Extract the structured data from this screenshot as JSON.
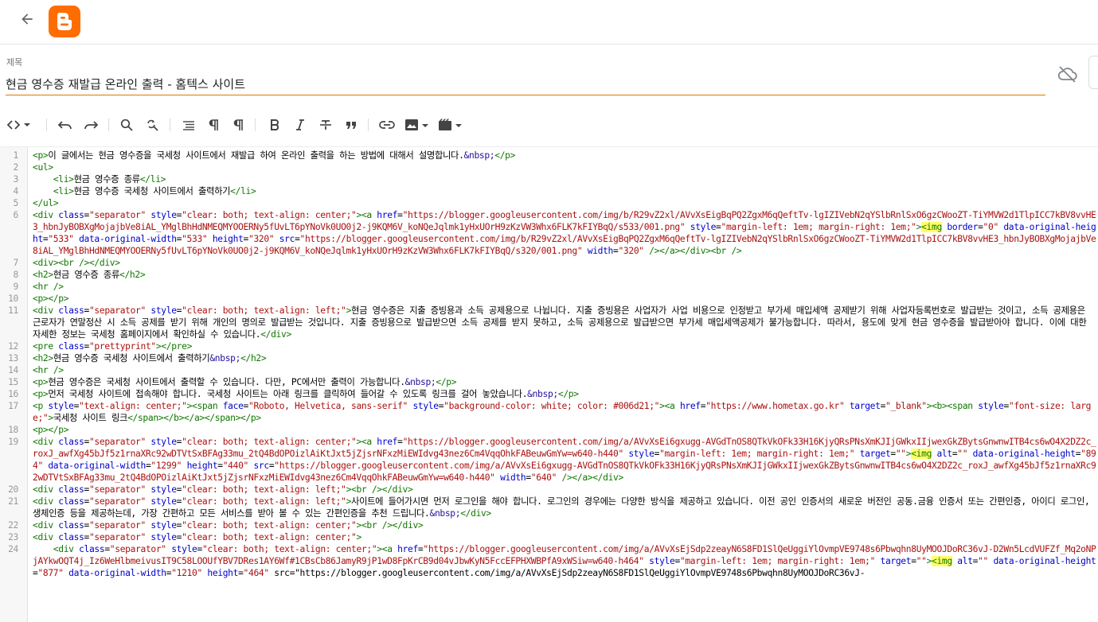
{
  "app": {
    "title_label": "제목",
    "post_title": "현금 영수증 재발급 온라인 출력 - 홈텍스 사이트"
  },
  "colors": {
    "brand": "#ff6d00",
    "title_underline": "#e37400"
  },
  "icons": {
    "back": "arrow-left-icon",
    "logo": "blogger-logo",
    "cloud": "cloud-off-icon"
  },
  "toolbar": [
    {
      "name": "html-view-toggle",
      "icon": "code-icon"
    },
    {
      "name": "undo",
      "icon": "undo-icon"
    },
    {
      "name": "redo",
      "icon": "redo-icon"
    },
    {
      "name": "find",
      "icon": "search-icon"
    },
    {
      "name": "replace",
      "icon": "find-replace-icon"
    },
    {
      "name": "format",
      "icon": "format-lines-icon"
    },
    {
      "name": "paragraph",
      "icon": "pilcrow-icon"
    },
    {
      "name": "paragraph-alt",
      "icon": "pilcrow-icon"
    },
    {
      "name": "bold",
      "icon": "bold-icon"
    },
    {
      "name": "italic",
      "icon": "italic-icon"
    },
    {
      "name": "strikethrough",
      "icon": "strikethrough-icon"
    },
    {
      "name": "quote",
      "icon": "quote-icon"
    },
    {
      "name": "link",
      "icon": "link-icon"
    },
    {
      "name": "image",
      "icon": "image-icon"
    },
    {
      "name": "video",
      "icon": "video-icon"
    }
  ],
  "code_lines": [
    {
      "n": "1",
      "t": "<p>이 글에서는 현금 영수증을 국세청 사이트에서 재발급 하여 온라인 출력을 하는 방법에 대해서 설명합니다.&nbsp;</p>"
    },
    {
      "n": "2",
      "t": "<ul>"
    },
    {
      "n": "3",
      "t": "    <li>현금 영수증 종류</li>"
    },
    {
      "n": "4",
      "t": "    <li>현금 영수증 국세청 사이트에서 출력하기</li>"
    },
    {
      "n": "5",
      "t": "</ul>"
    },
    {
      "n": "6",
      "t": "<div class=\"separator\" style=\"clear: both; text-align: center;\"><a href=\"https://blogger.googleusercontent.com/img/b/R29vZ2xl/AVvXsEigBqPQ2ZgxM6qQeftTv-lgIZIVebN2qYSlbRnlSxO6gzCWooZT-TiYMVW2d1TlpICC7kBV8vvHE3_hbnJyBOBXgMojajbVe8iAL_YMglBhHdNMEQMYOOERNy5fUvLT6pYNoVk0UO0j2-j9KQM6V_koNQeJqlmk1yHxUOrH9zKzVW3Whx6FLK7kFIYBqQ/s533/001.png\" style=\"margin-left: 1em; margin-right: 1em;\"><img border=\"0\" data-original-height=\"533\" data-original-width=\"533\" height=\"320\" src=\"https://blogger.googleusercontent.com/img/b/R29vZ2xl/AVvXsEigBqPQ2ZgxM6qQeftTv-lgIZIVebN2qYSlbRnlSxO6gzCWooZT-TiYMVW2d1TlpICC7kBV8vvHE3_hbnJyBOBXgMojajbVe8iAL_YMglBhHdNMEQMYOOERNy5fUvLT6pYNoVk0UO0j2-j9KQM6V_koNQeJqlmk1yHxUOrH9zKzVW3Whx6FLK7kFIYBqQ/s320/001.png\" width=\"320\" /></a></div><br />"
    },
    {
      "n": "7",
      "t": "<div><br /></div>"
    },
    {
      "n": "8",
      "t": "<h2>현금 영수증 종류</h2>"
    },
    {
      "n": "9",
      "t": "<hr />"
    },
    {
      "n": "10",
      "t": "<p></p>"
    },
    {
      "n": "11",
      "t": "<div class=\"separator\" style=\"clear: both; text-align: left;\">현금 영수증은 지출 증빙용과 소득 공제용으로 나뉩니다. 지출 증빙용은 사업자가 사업 비용으로 인정받고 부가세 매입세액 공제받기 위해 사업자등록번호로 발급받는 것이고, 소득 공제용은 근로자가 연말정산 시 소득 공제를 받기 위해 개인의 명의로 발급받는 것입니다. 지출 증빙용으로 발급받으면 소득 공제를 받지 못하고, 소득 공제용으로 발급받으면 부가세 매입세액공제가 불가능합니다. 따라서, 용도에 맞게 현금 영수증을 발급받아야 합니다. 이에 대한 자세한 정보는 국세청 홈페이지에서 확인하실 수 있습니다.</div>"
    },
    {
      "n": "12",
      "t": "<pre class=\"prettyprint\"></pre>"
    },
    {
      "n": "13",
      "t": "<h2>현금 영수증 국세청 사이트에서 출력하기&nbsp;</h2>"
    },
    {
      "n": "14",
      "t": "<hr />"
    },
    {
      "n": "15",
      "t": "<p>현금 영수증은 국세청 사이트에서 출력할 수 있습니다. 다만, PC에서만 출력이 가능합니다.&nbsp;</p>"
    },
    {
      "n": "16",
      "t": "<p>먼저 국세청 사이트에 접속해야 합니다. 국세청 사이트는 아래 링크를 클릭하여 들어갈 수 있도록 링크를 걸어 놓았습니다.&nbsp;</p>"
    },
    {
      "n": "17",
      "t": "<p style=\"text-align: center;\"><span face=\"Roboto, Helvetica, sans-serif\" style=\"background-color: white; color: #006d21;\"><a href=\"https://www.hometax.go.kr\" target=\"_blank\"><b><span style=\"font-size: large;\">국세청 사이트 링크</span></b></a></span></p>"
    },
    {
      "n": "18",
      "t": "<p></p>"
    },
    {
      "n": "19",
      "t": "<div class=\"separator\" style=\"clear: both; text-align: center;\"><a href=\"https://blogger.googleusercontent.com/img/a/AVvXsEi6gxugg-AVGdTnOS8QTkVkOFk33H16KjyQRsPNsXmKJIjGWkxIIjwexGkZBytsGnwnwITB4cs6wO4X2DZ2c_roxJ_awfXg45bJf5z1rnaXRc92wDTVtSxBFAg33mu_2tQ4BdOPOizlAiKtJxt5jZjsrNFxzMiEWIdvg43nez6Cm4VqqOhkFABeuwGmYw=w640-h440\" style=\"margin-left: 1em; margin-right: 1em;\" target=\"\"><img alt=\"\" data-original-height=\"894\" data-original-width=\"1299\" height=\"440\" src=\"https://blogger.googleusercontent.com/img/a/AVvXsEi6gxugg-AVGdTnOS8QTkVkOFk33H16KjyQRsPNsXmKJIjGWkxIIjwexGkZBytsGnwnwITB4cs6wO4X2DZ2c_roxJ_awfXg45bJf5z1rnaXRc92wDTVtSxBFAg33mu_2tQ4BdOPOizlAiKtJxt5jZjsrNFxzMiEWIdvg43nez6Cm4VqqOhkFABeuwGmYw=w640-h440\" width=\"640\" /></a></div>"
    },
    {
      "n": "20",
      "t": "<div class=\"separator\" style=\"clear: both; text-align: left;\"><br /></div>"
    },
    {
      "n": "21",
      "t": "<div class=\"separator\" style=\"clear: both; text-align: left;\">사이트에 들어가시면 먼저 로그인을 해야 합니다. 로그인의 경우에는 다양한 방식을 제공하고 있습니다. 이전 공인 인증서의 새로운 버전인 공동.금융 인증서 또는 간편인증, 아이디 로그인, 생체인증 등을 제공하는데, 가장 간편하고 모든 서비스를 받아 볼 수 있는 간편인증을 추천 드립니다.&nbsp;</div>"
    },
    {
      "n": "22",
      "t": "<div class=\"separator\" style=\"clear: both; text-align: center;\"><br /></div>"
    },
    {
      "n": "23",
      "t": "<div class=\"separator\" style=\"clear: both; text-align: center;\">"
    },
    {
      "n": "24",
      "t": "    <div class=\"separator\" style=\"clear: both; text-align: center;\"><a href=\"https://blogger.googleusercontent.com/img/a/AVvXsEjSdp2zeayN6S8FD1SlQeUggiYlOvmpVE9748s6Pbwqhn8UyMOOJDoRC36vJ-D2Wn5LcdVUFZf_Mq2oNPjAYkwOQT4j_Iz6WeHlbmeivusIT9C58LOOUfYBV7DRes1AY6Wf#1CBsCb86JamyR9jP1wD8FpKrCB9d04vJbwKyN5FccEFPHXWBPfA9xWSiw=w640-h464\" style=\"margin-left: 1em; margin-right: 1em;\" target=\"\"><img alt=\"\" data-original-height=\"877\" data-original-width=\"1210\" height=\"464\" src=\"https://blogger.googleusercontent.com/img/a/AVvXsEjSdp2zeayN6S8FD1SlQeUggiYlOvmpVE9748s6Pbwqhn8UyMOOJDoRC36vJ-"
    }
  ]
}
